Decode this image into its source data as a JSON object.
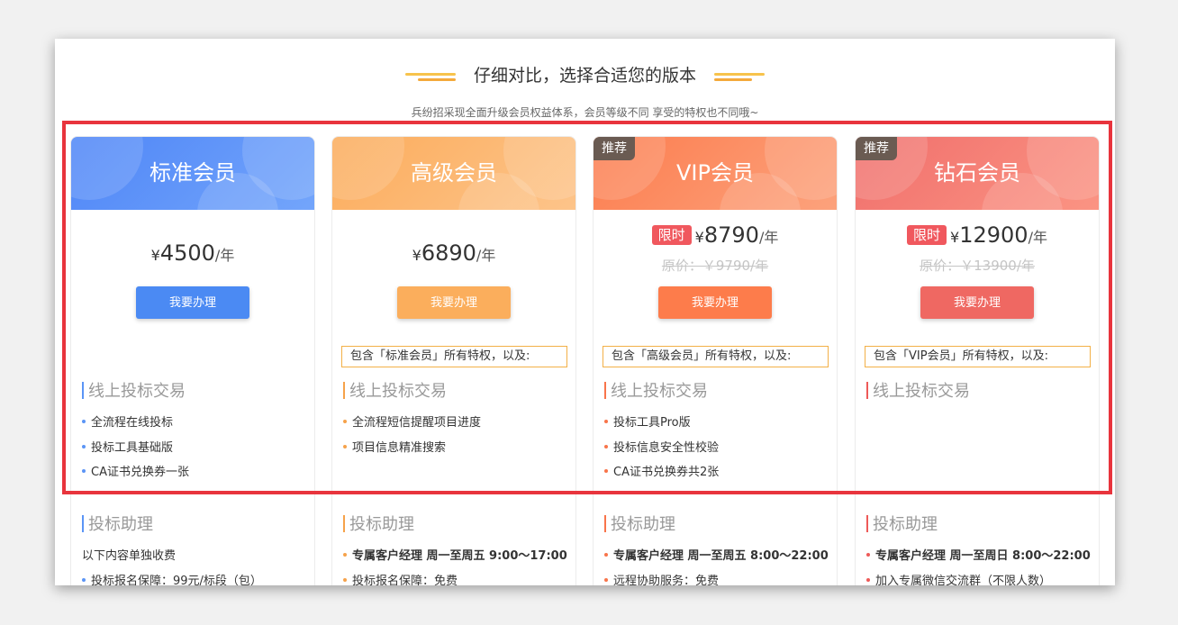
{
  "header": {
    "title": "仔细对比，选择合适您的版本",
    "subtitle": "兵纷招采现全面升级会员权益体系，会员等级不同 享受的特权也不同哦~"
  },
  "plans": [
    {
      "name": "标准会员",
      "badge": "",
      "limit_tag": "",
      "currency": "¥",
      "price": "4500",
      "unit": "/年",
      "original_price": "",
      "button": "我要办理",
      "includes": "",
      "section1_title": "线上投标交易",
      "section1_items": [
        "全流程在线投标",
        "投标工具基础版",
        "CA证书兑换券一张"
      ],
      "section2_title": "投标助理",
      "section2_note": "以下内容单独收费",
      "section2_items": [
        "投标报名保障：99元/标段（包）"
      ],
      "colors": {
        "head_from": "#4f86f7",
        "head_to": "#73a5fb",
        "button": "#4b8af3",
        "accent": "#5b95f6"
      }
    },
    {
      "name": "高级会员",
      "badge": "",
      "limit_tag": "",
      "currency": "¥",
      "price": "6890",
      "unit": "/年",
      "original_price": "",
      "button": "我要办理",
      "includes": "包含「标准会员」所有特权，以及:",
      "section1_title": "线上投标交易",
      "section1_items": [
        "全流程短信提醒项目进度",
        "项目信息精准搜索"
      ],
      "section2_title": "投标助理",
      "section2_note": "",
      "section2_items": [
        "专属客户经理 周一至周五 9:00～17:00",
        "投标报名保障：免费"
      ],
      "colors": {
        "head_from": "#fbac5c",
        "head_to": "#fdc48a",
        "button": "#fbae5c",
        "accent": "#f6a24a"
      }
    },
    {
      "name": "VIP会员",
      "badge": "推荐",
      "limit_tag": "限时",
      "currency": "¥",
      "price": "8790",
      "unit": "/年",
      "original_price": "原价：￥9790/年",
      "button": "我要办理",
      "includes": "包含「高级会员」所有特权，以及:",
      "section1_title": "线上投标交易",
      "section1_items": [
        "投标工具Pro版",
        "投标信息安全性校验",
        "CA证书兑换券共2张"
      ],
      "section2_title": "投标助理",
      "section2_note": "",
      "section2_items": [
        "专属客户经理 周一至周五 8:00～22:00",
        "远程协助服务：免费"
      ],
      "colors": {
        "head_from": "#fc7d4f",
        "head_to": "#fca27c",
        "button": "#fd7c4b",
        "accent": "#f8744a"
      }
    },
    {
      "name": "钻石会员",
      "badge": "推荐",
      "limit_tag": "限时",
      "currency": "¥",
      "price": "12900",
      "unit": "/年",
      "original_price": "原价：￥13900/年",
      "button": "我要办理",
      "includes": "包含「VIP会员」所有特权，以及:",
      "section1_title": "线上投标交易",
      "section1_items": [],
      "section2_title": "投标助理",
      "section2_note": "",
      "section2_items": [
        "专属客户经理 周一至周日 8:00～22:00",
        "加入专属微信交流群（不限人数）"
      ],
      "colors": {
        "head_from": "#f06f6c",
        "head_to": "#fb9483",
        "button": "#ef6862",
        "accent": "#ee5a58"
      }
    }
  ]
}
